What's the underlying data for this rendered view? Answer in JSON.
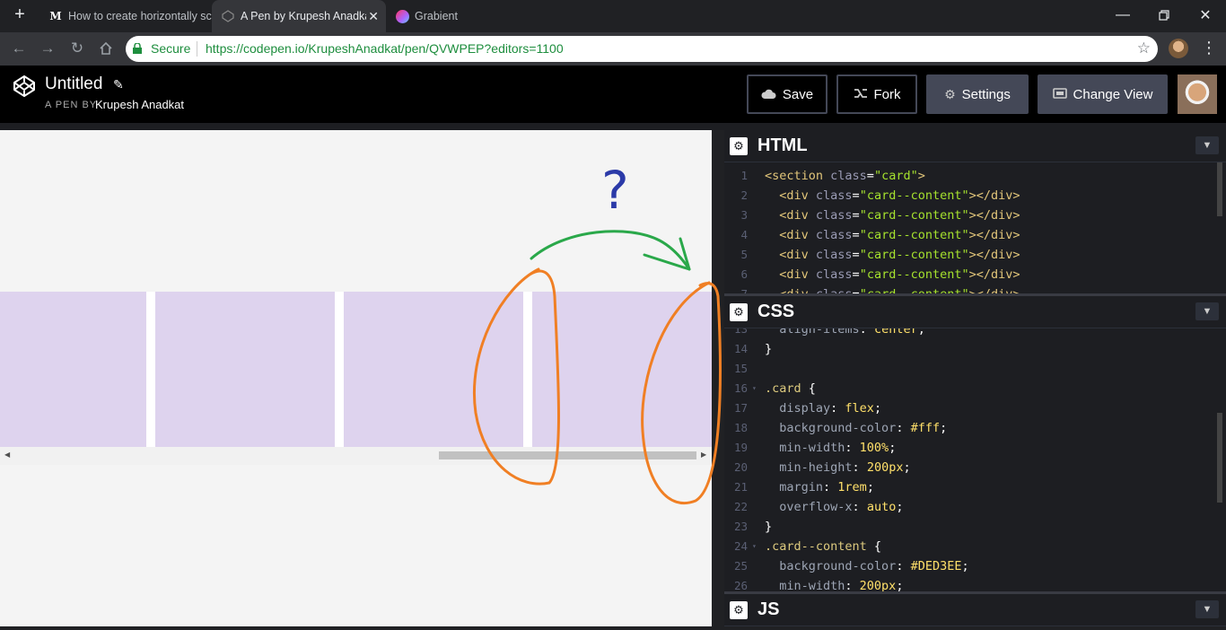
{
  "browser": {
    "tabs": [
      {
        "favicon": "M",
        "title": "How to create horizontally sc"
      },
      {
        "favicon": "codepen",
        "title": "A Pen by Krupesh Anadkat",
        "close": "✕"
      },
      {
        "favicon": "grabient",
        "title": "Grabient"
      }
    ],
    "new_tab": "+",
    "secure_label": "Secure",
    "url": "https://codepen.io/KrupeshAnadkat/pen/QVWPEP?editors=1100"
  },
  "codepen": {
    "title": "Untitled",
    "by_label": "A PEN BY",
    "author": "Krupesh Anadkat",
    "buttons": {
      "save": "Save",
      "fork": "Fork",
      "settings": "Settings",
      "change_view": "Change View"
    }
  },
  "editors": {
    "html": {
      "label": "HTML",
      "lines": [
        {
          "n": "1",
          "segs": [
            [
              "tag",
              "<section "
            ],
            [
              "aname",
              "class"
            ],
            [
              "pun",
              "="
            ],
            [
              "str",
              "\"card\""
            ],
            [
              "tag",
              ">"
            ]
          ]
        },
        {
          "n": "2",
          "segs": [
            [
              "pun",
              "  "
            ],
            [
              "tag",
              "<div "
            ],
            [
              "aname",
              "class"
            ],
            [
              "pun",
              "="
            ],
            [
              "str",
              "\"card--content\""
            ],
            [
              "tag",
              "></div>"
            ]
          ]
        },
        {
          "n": "3",
          "segs": [
            [
              "pun",
              "  "
            ],
            [
              "tag",
              "<div "
            ],
            [
              "aname",
              "class"
            ],
            [
              "pun",
              "="
            ],
            [
              "str",
              "\"card--content\""
            ],
            [
              "tag",
              "></div>"
            ]
          ]
        },
        {
          "n": "4",
          "segs": [
            [
              "pun",
              "  "
            ],
            [
              "tag",
              "<div "
            ],
            [
              "aname",
              "class"
            ],
            [
              "pun",
              "="
            ],
            [
              "str",
              "\"card--content\""
            ],
            [
              "tag",
              "></div>"
            ]
          ]
        },
        {
          "n": "5",
          "segs": [
            [
              "pun",
              "  "
            ],
            [
              "tag",
              "<div "
            ],
            [
              "aname",
              "class"
            ],
            [
              "pun",
              "="
            ],
            [
              "str",
              "\"card--content\""
            ],
            [
              "tag",
              "></div>"
            ]
          ]
        },
        {
          "n": "6",
          "segs": [
            [
              "pun",
              "  "
            ],
            [
              "tag",
              "<div "
            ],
            [
              "aname",
              "class"
            ],
            [
              "pun",
              "="
            ],
            [
              "str",
              "\"card--content\""
            ],
            [
              "tag",
              "></div>"
            ]
          ]
        },
        {
          "n": "7",
          "segs": [
            [
              "pun",
              "  "
            ],
            [
              "tag",
              "<div "
            ],
            [
              "aname",
              "class"
            ],
            [
              "pun",
              "="
            ],
            [
              "str",
              "\"card--content\""
            ],
            [
              "tag",
              "></div>"
            ]
          ]
        }
      ]
    },
    "css": {
      "label": "CSS",
      "lines": [
        {
          "n": "13",
          "segs": [
            [
              "prop",
              "  align-items"
            ],
            [
              "pun",
              ": "
            ],
            [
              "val",
              "center"
            ],
            [
              "pun",
              ";"
            ]
          ]
        },
        {
          "n": "14",
          "segs": [
            [
              "pun",
              "}"
            ]
          ]
        },
        {
          "n": "15",
          "segs": []
        },
        {
          "n": "16",
          "fold": true,
          "segs": [
            [
              "sel",
              ".card"
            ],
            [
              "pun",
              " {"
            ]
          ]
        },
        {
          "n": "17",
          "segs": [
            [
              "prop",
              "  display"
            ],
            [
              "pun",
              ": "
            ],
            [
              "val",
              "flex"
            ],
            [
              "pun",
              ";"
            ]
          ]
        },
        {
          "n": "18",
          "segs": [
            [
              "prop",
              "  background-color"
            ],
            [
              "pun",
              ": "
            ],
            [
              "val",
              "#fff"
            ],
            [
              "pun",
              ";"
            ]
          ]
        },
        {
          "n": "19",
          "segs": [
            [
              "prop",
              "  min-width"
            ],
            [
              "pun",
              ": "
            ],
            [
              "val",
              "100%"
            ],
            [
              "pun",
              ";"
            ]
          ]
        },
        {
          "n": "20",
          "segs": [
            [
              "prop",
              "  min-height"
            ],
            [
              "pun",
              ": "
            ],
            [
              "val",
              "200px"
            ],
            [
              "pun",
              ";"
            ]
          ]
        },
        {
          "n": "21",
          "segs": [
            [
              "prop",
              "  margin"
            ],
            [
              "pun",
              ": "
            ],
            [
              "val",
              "1rem"
            ],
            [
              "pun",
              ";"
            ]
          ]
        },
        {
          "n": "22",
          "segs": [
            [
              "prop",
              "  overflow-x"
            ],
            [
              "pun",
              ": "
            ],
            [
              "val",
              "auto"
            ],
            [
              "pun",
              ";"
            ]
          ]
        },
        {
          "n": "23",
          "segs": [
            [
              "pun",
              "}"
            ]
          ]
        },
        {
          "n": "24",
          "fold": true,
          "segs": [
            [
              "sel",
              ".card--content"
            ],
            [
              "pun",
              " {"
            ]
          ]
        },
        {
          "n": "25",
          "segs": [
            [
              "prop",
              "  background-color"
            ],
            [
              "pun",
              ": "
            ],
            [
              "val",
              "#DED3EE"
            ],
            [
              "pun",
              ";"
            ]
          ]
        },
        {
          "n": "26",
          "segs": [
            [
              "prop",
              "  min-width"
            ],
            [
              "pun",
              ": "
            ],
            [
              "val",
              "200px"
            ],
            [
              "pun",
              ";"
            ]
          ]
        }
      ]
    },
    "js": {
      "label": "JS"
    }
  },
  "preview": {
    "card_color": "#DED3EE",
    "annotation": {
      "question_mark": "?"
    }
  }
}
